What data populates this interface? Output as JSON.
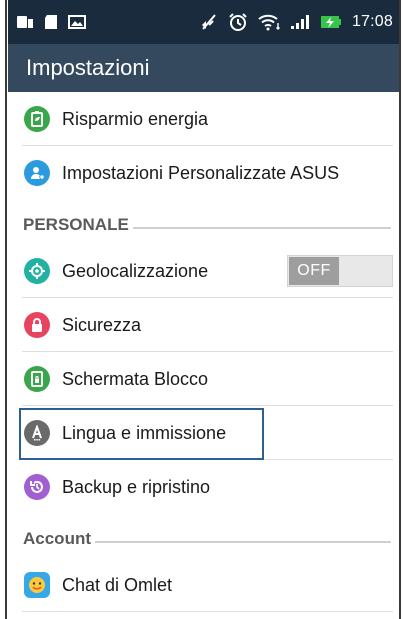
{
  "status_bar": {
    "time": "17:08",
    "icons": [
      "sim-card-icon",
      "sd-card-icon",
      "image-icon",
      "mute-icon",
      "alarm-icon",
      "wifi-icon",
      "signal-icon",
      "battery-charging-icon"
    ]
  },
  "app_bar": {
    "title": "Impostazioni"
  },
  "items": {
    "risparmio": {
      "label": "Risparmio energia",
      "icon": "battery-saver-icon",
      "color": "#3aa64b"
    },
    "asus": {
      "label": "Impostazioni Personalizzate ASUS",
      "icon": "asus-settings-icon",
      "color": "#2b9adf"
    },
    "geo": {
      "label": "Geolocalizzazione",
      "icon": "location-icon",
      "color": "#23b1a3",
      "toggle": "OFF"
    },
    "sicurezza": {
      "label": "Sicurezza",
      "icon": "lock-icon",
      "color": "#e8445f"
    },
    "blocco": {
      "label": "Schermata Blocco",
      "icon": "lock-screen-icon",
      "color": "#3aa64b"
    },
    "lingua": {
      "label": "Lingua e immissione",
      "icon": "language-icon",
      "color": "#6a6a6a"
    },
    "backup": {
      "label": "Backup e ripristino",
      "icon": "backup-icon",
      "color": "#a15fd1"
    },
    "omlet": {
      "label": "Chat di Omlet",
      "icon": "omlet-icon",
      "color": "#36a8e8"
    }
  },
  "sections": {
    "personale": "PERSONALE",
    "account": "Account"
  }
}
